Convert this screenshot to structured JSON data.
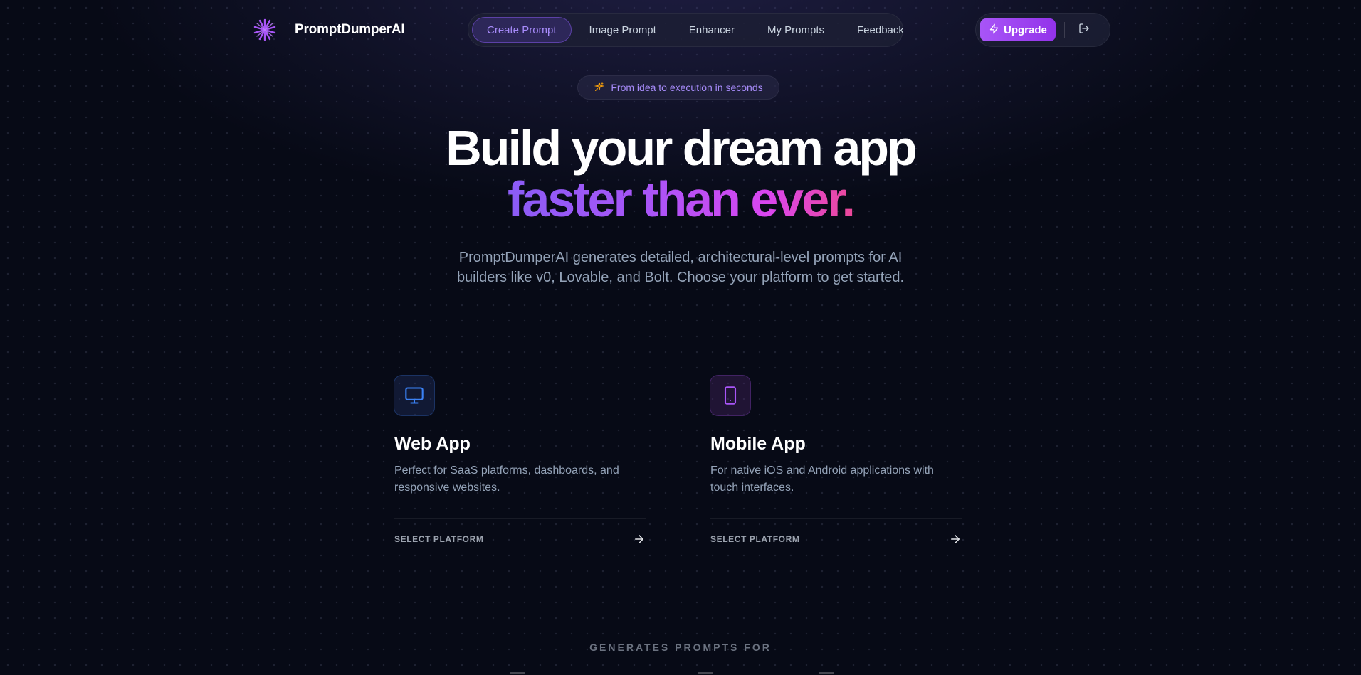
{
  "header": {
    "brand_name": "PromptDumperAI",
    "logo_icon": "sparkle-logo-icon",
    "nav_tabs": [
      {
        "label": "Create Prompt",
        "active": true
      },
      {
        "label": "Image Prompt",
        "active": false
      },
      {
        "label": "Enhancer",
        "active": false
      },
      {
        "label": "My Prompts",
        "active": false
      },
      {
        "label": "Feedback",
        "active": false
      }
    ],
    "upgrade_label": "Upgrade",
    "upgrade_icon": "lightning-icon",
    "logout_icon": "logout-icon"
  },
  "hero": {
    "badge_icon": "sparkles-icon",
    "badge_text": "From idea to execution in seconds",
    "title_line1": "Build your dream app",
    "title_line2": "faster than ever.",
    "subtitle": "PromptDumperAI generates detailed, architectural-level prompts for AI builders like v0, Lovable, and Bolt. Choose your platform to get started."
  },
  "cards": [
    {
      "icon": "monitor-icon",
      "title": "Web App",
      "description": "Perfect for SaaS platforms, dashboards, and responsive websites.",
      "cta": "SELECT PLATFORM"
    },
    {
      "icon": "smartphone-icon",
      "title": "Mobile App",
      "description": "For native iOS and Android applications with touch interfaces.",
      "cta": "SELECT PLATFORM"
    }
  ],
  "footer": {
    "generates_label": "GENERATES PROMPTS FOR"
  },
  "colors": {
    "accent": "#a855f7",
    "background": "#070a16",
    "web_icon": "#3b82f6",
    "mobile_icon": "#a855f7"
  }
}
